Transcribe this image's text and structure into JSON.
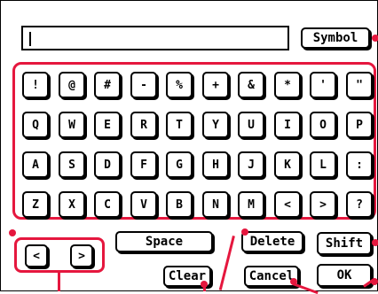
{
  "input": {
    "value": ""
  },
  "symbol_label": "Symbol",
  "keys": {
    "row1": [
      "!",
      "@",
      "#",
      "-",
      "%",
      "+",
      "&",
      "*",
      "'",
      "\""
    ],
    "row2": [
      "Q",
      "W",
      "E",
      "R",
      "T",
      "Y",
      "U",
      "I",
      "O",
      "P"
    ],
    "row3": [
      "A",
      "S",
      "D",
      "F",
      "G",
      "H",
      "J",
      "K",
      "L",
      ":"
    ],
    "row4": [
      "Z",
      "X",
      "C",
      "V",
      "B",
      "N",
      "M",
      "<",
      ">",
      "?"
    ]
  },
  "nav": {
    "left": "<",
    "right": ">"
  },
  "buttons": {
    "space": "Space",
    "delete": "Delete",
    "shift": "Shift",
    "clear": "Clear",
    "cancel": "Cancel",
    "ok": "OK"
  },
  "colors": {
    "callout": "#e5173e"
  }
}
